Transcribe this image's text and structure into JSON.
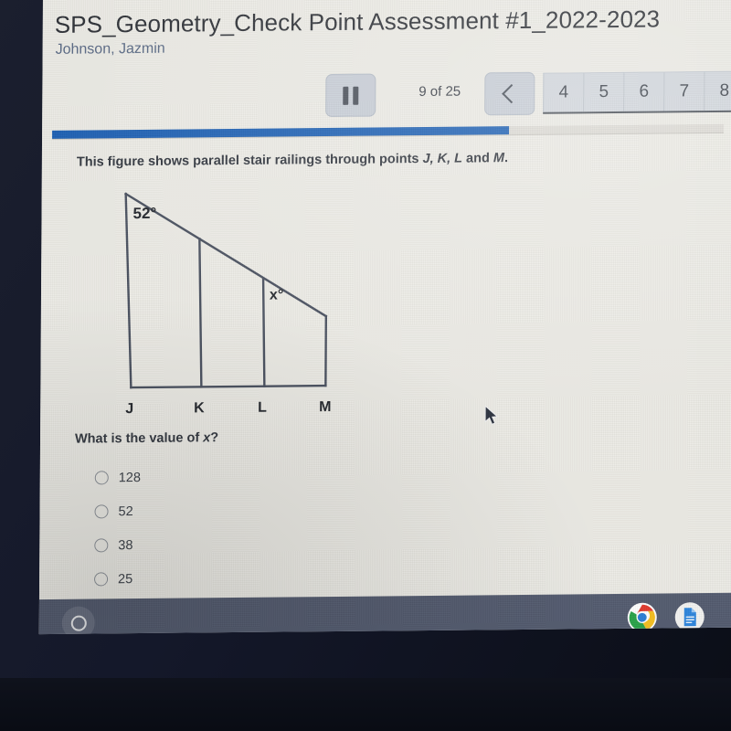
{
  "header": {
    "title": "SPS_Geometry_Check Point Assessment #1_2022-2023",
    "student": "Johnson, Jazmin"
  },
  "toolbar": {
    "pause_label": "Pause",
    "progress_count": "9 of 25",
    "prev_label": "Previous",
    "pages": [
      "4",
      "5",
      "6",
      "7",
      "8"
    ]
  },
  "progress": {
    "percent": 68
  },
  "question": {
    "stem_prefix": "This figure shows parallel stair railings through points ",
    "stem_points": "J, K, L",
    "stem_join": " and ",
    "stem_last": "M",
    "stem_end": ".",
    "prompt_prefix": "What is the value of ",
    "prompt_var": "x",
    "prompt_suffix": "?",
    "options": [
      {
        "label": "128",
        "selected": false
      },
      {
        "label": "52",
        "selected": false
      },
      {
        "label": "38",
        "selected": false
      },
      {
        "label": "25",
        "selected": false
      }
    ]
  },
  "figure": {
    "angle_top_label": "52°",
    "angle_x_label": "x°",
    "vertex_labels": [
      "J",
      "K",
      "L",
      "M"
    ],
    "line_color": "#4a5160",
    "description": "Trapezoid with slanted top edge; vertical railings at J, K, L and M on a horizontal base."
  },
  "shelf": {
    "launcher_name": "launcher",
    "apps": [
      "chrome",
      "google-docs"
    ]
  },
  "colors": {
    "accent_blue": "#1f62b5",
    "page_background": "#edece6",
    "shelf_background": "#545c70",
    "title_text": "#2f3238",
    "subtitle_text": "#5b6b86"
  }
}
